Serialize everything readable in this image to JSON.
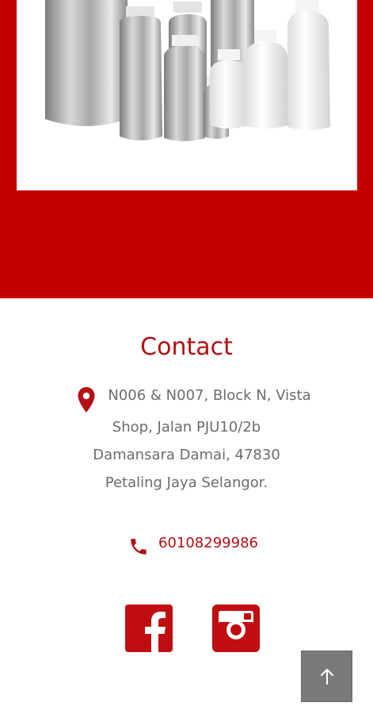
{
  "hero": {
    "bg_color": "#c50000",
    "image_alt": "aluminium-and-plastic-bottles"
  },
  "contact": {
    "title": "Contact",
    "address_lines": [
      "N006 & N007, Block N, Vista",
      "Shop, Jalan PJU10/2b",
      "Damansara Damai, 47830",
      "Petaling Jaya Selangor."
    ],
    "phone": "60108299986",
    "accent_color": "#b40f14"
  },
  "social": {
    "facebook_icon": "facebook-icon",
    "instagram_icon": "instagram-icon"
  },
  "scroll_top": {
    "icon": "arrow-up-icon",
    "bg_color": "#7a7a7a"
  }
}
